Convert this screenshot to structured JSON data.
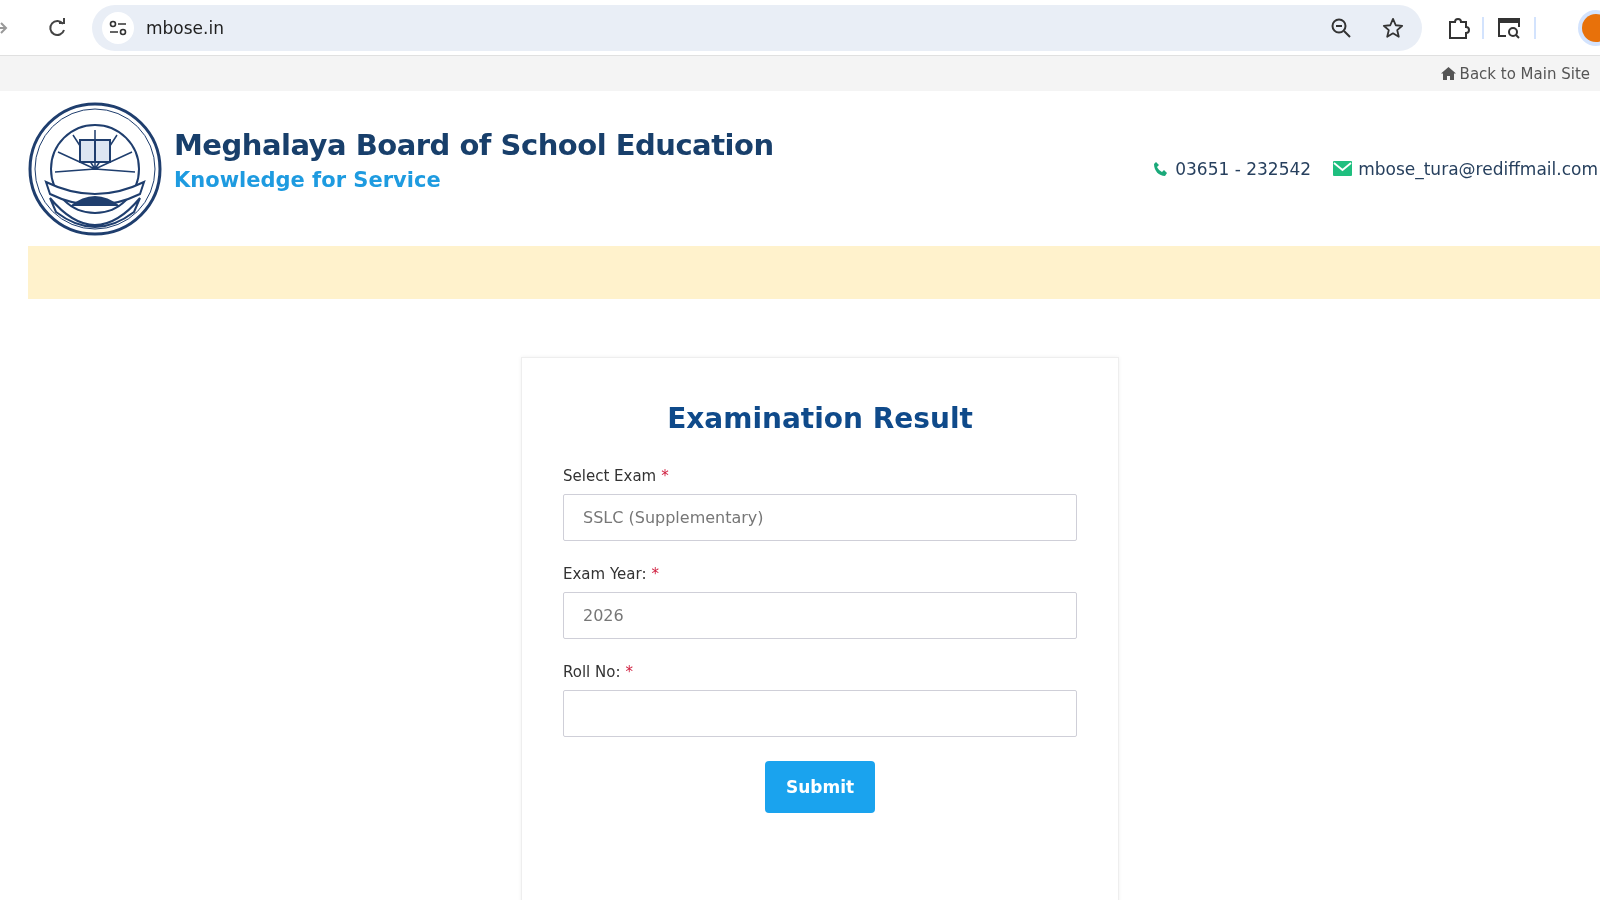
{
  "browser": {
    "url": "mbose.in"
  },
  "top_bar": {
    "link": "Back to Main Site"
  },
  "header": {
    "title": "Meghalaya Board of School Education",
    "tagline": "Knowledge for Service",
    "phone": "03651 - 232542",
    "email": "mbose_tura@rediffmail.com"
  },
  "form": {
    "title": "Examination Result",
    "fields": [
      {
        "label": "Select Exam",
        "required_mark": "*",
        "value": "SSLC (Supplementary)"
      },
      {
        "label": "Exam Year:",
        "required_mark": "*",
        "value": "2026"
      },
      {
        "label": "Roll No:",
        "required_mark": "*"
      }
    ],
    "submit": "Submit"
  }
}
